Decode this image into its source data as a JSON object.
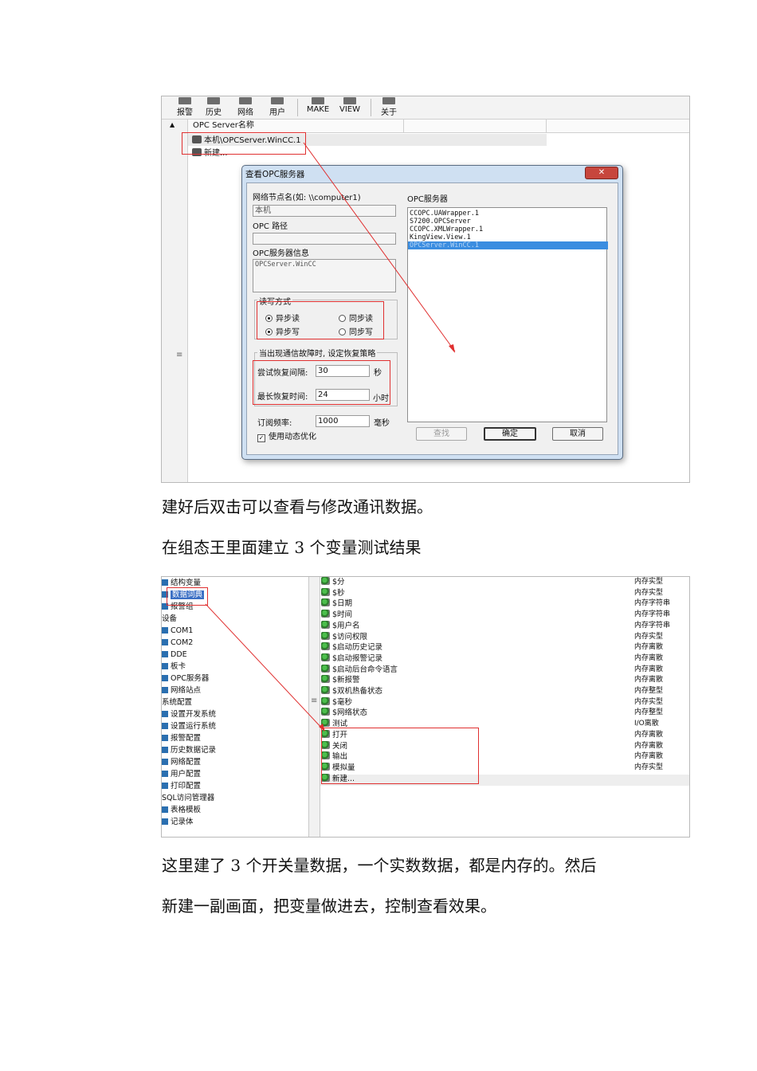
{
  "screenshot1": {
    "toolbar": [
      {
        "label": "报警",
        "icon": "alarm-icon"
      },
      {
        "label": "历史",
        "icon": "history-icon"
      },
      {
        "label": "网络",
        "icon": "network-icon"
      },
      {
        "label": "用户",
        "icon": "user-icon"
      },
      {
        "label": "MAKE",
        "icon": "make-icon"
      },
      {
        "label": "VIEW",
        "icon": "view-icon"
      },
      {
        "label": "关于",
        "icon": "about-icon"
      }
    ],
    "list_header": "OPC Server名称",
    "rows": [
      "本机\\OPCServer.WinCC.1",
      "新建..."
    ],
    "splitter_glyph": "≡",
    "dialog": {
      "title": "查看OPC服务器",
      "close": "✕",
      "node_label": "网络节点名(如: \\\\computer1)",
      "node_value": "本机",
      "path_label": "OPC 路径",
      "path_value": "",
      "info_label": "OPC服务器信息",
      "info_value": "OPCServer.WinCC",
      "rw_group": "读写方式",
      "radios": [
        {
          "label": "异步读",
          "checked": true
        },
        {
          "label": "同步读",
          "checked": false
        },
        {
          "label": "异步写",
          "checked": true
        },
        {
          "label": "同步写",
          "checked": false
        }
      ],
      "fail_group": "当出现通信故障时, 设定恢复策略",
      "retry_label": "尝试恢复间隔:",
      "retry_value": "30",
      "retry_unit": "秒",
      "maxtime_label": "最长恢复时间:",
      "maxtime_value": "24",
      "maxtime_unit": "小时",
      "sub_label": "订阅频率:",
      "sub_value": "1000",
      "sub_unit": "毫秒",
      "dyn_check": "使用动态优化",
      "dyn_checked": true,
      "server_list_label": "OPC服务器",
      "servers": [
        "CCOPC.UAWrapper.1",
        "S7200.OPCServer",
        "CCOPC.XMLWrapper.1",
        "KingView.View.1",
        "OPCServer.WinCC.1"
      ],
      "selected_server": 4,
      "btn_find": "查找",
      "btn_ok": "确定",
      "btn_cancel": "取消"
    }
  },
  "text": {
    "line1": "建好后双击可以查看与修改通讯数据。",
    "line2": "在组态王里面建立 3 个变量测试结果",
    "line3": "这里建了 3 个开关量数据，一个实数数据，都是内存的。然后",
    "line4": "新建一副画面，把变量做进去，控制查看效果。"
  },
  "screenshot2": {
    "tree": [
      "结构变量",
      "数据词典",
      "报警组",
      "设备",
      "COM1",
      "COM2",
      "DDE",
      "板卡",
      "OPC服务器",
      "网络站点",
      "系统配置",
      "设置开发系统",
      "设置运行系统",
      "报警配置",
      "历史数据记录",
      "网络配置",
      "用户配置",
      "打印配置",
      "SQL访问管理器",
      "表格模板",
      "记录体"
    ],
    "splitter_glyph": "≡",
    "variables": [
      {
        "name": "$分",
        "type": "内存实型"
      },
      {
        "name": "$秒",
        "type": "内存实型"
      },
      {
        "name": "$日期",
        "type": "内存字符串"
      },
      {
        "name": "$时间",
        "type": "内存字符串"
      },
      {
        "name": "$用户名",
        "type": "内存字符串"
      },
      {
        "name": "$访问权限",
        "type": "内存实型"
      },
      {
        "name": "$启动历史记录",
        "type": "内存离散"
      },
      {
        "name": "$启动报警记录",
        "type": "内存离散"
      },
      {
        "name": "$启动后台命令语言",
        "type": "内存离散"
      },
      {
        "name": "$新报警",
        "type": "内存离散"
      },
      {
        "name": "$双机热备状态",
        "type": "内存整型"
      },
      {
        "name": "$毫秒",
        "type": "内存实型"
      },
      {
        "name": "$网络状态",
        "type": "内存整型"
      },
      {
        "name": "测试",
        "type": "I/O离散"
      },
      {
        "name": "打开",
        "type": "内存离散"
      },
      {
        "name": "关闭",
        "type": "内存离散"
      },
      {
        "name": "输出",
        "type": "内存离散"
      },
      {
        "name": "模拟量",
        "type": "内存实型"
      },
      {
        "name": "新建...",
        "type": ""
      }
    ]
  },
  "colors": {
    "annotation_red": "#e03030",
    "selection_blue": "#3b8de0",
    "dialog_frame": "#cfe0f2"
  }
}
